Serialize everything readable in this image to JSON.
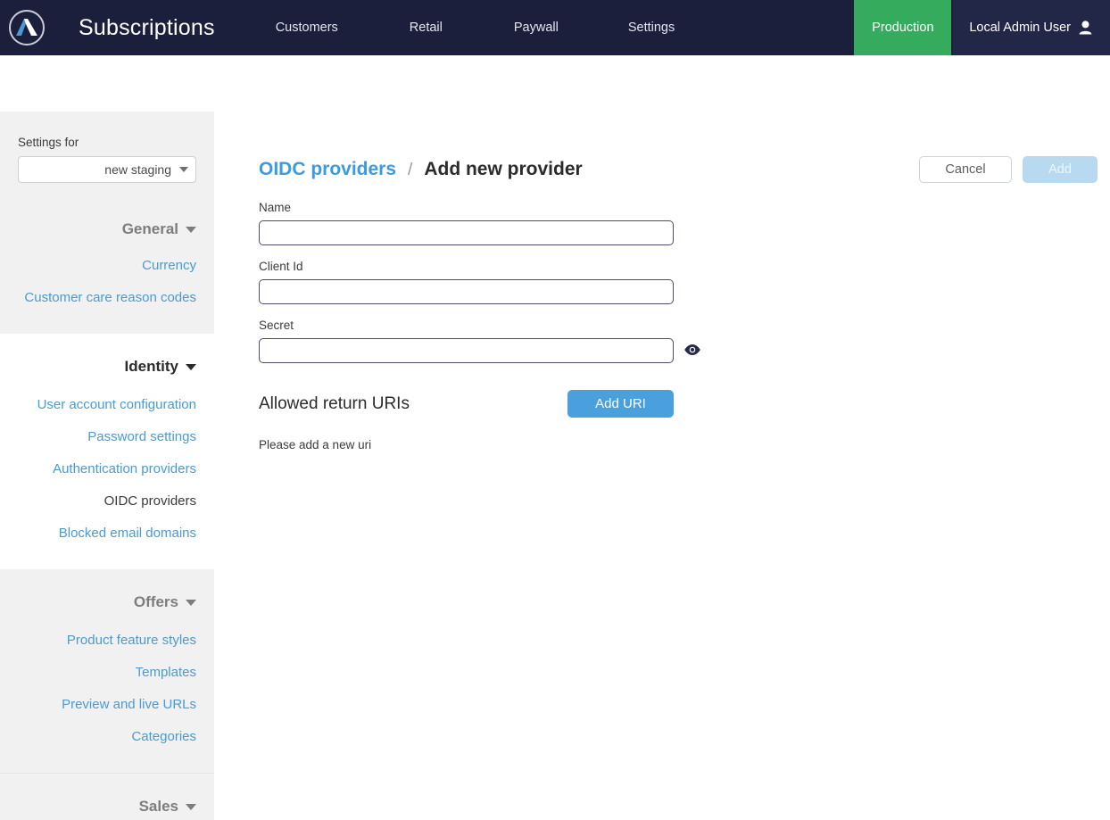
{
  "navbar": {
    "logo_name": "app-logo",
    "brand": "Subscriptions",
    "links": [
      {
        "label": "Customers",
        "name": "nav-link-customers"
      },
      {
        "label": "Retail",
        "name": "nav-link-retail"
      },
      {
        "label": "Paywall",
        "name": "nav-link-paywall"
      },
      {
        "label": "Settings",
        "name": "nav-link-settings"
      }
    ],
    "environment": "Production",
    "environment_color": "#35ab5e",
    "user": "Local Admin User",
    "background_color": "#1b1f3b"
  },
  "sidebar": {
    "settings_for_label": "Settings for",
    "environment_value": "new staging",
    "groups": [
      {
        "title": "General",
        "active": false,
        "links": [
          {
            "label": "Currency",
            "current": false
          },
          {
            "label": "Customer care reason codes",
            "current": false
          }
        ]
      },
      {
        "title": "Identity",
        "active": true,
        "links": [
          {
            "label": "User account configuration",
            "current": false
          },
          {
            "label": "Password settings",
            "current": false
          },
          {
            "label": "Authentication providers",
            "current": false
          },
          {
            "label": "OIDC providers",
            "current": true
          },
          {
            "label": "Blocked email domains",
            "current": false
          }
        ]
      },
      {
        "title": "Offers",
        "active": false,
        "links": [
          {
            "label": "Product feature styles",
            "current": false
          },
          {
            "label": "Templates",
            "current": false
          },
          {
            "label": "Preview and live URLs",
            "current": false
          },
          {
            "label": "Categories",
            "current": false
          }
        ]
      },
      {
        "title": "Sales",
        "active": false,
        "links": []
      }
    ]
  },
  "main": {
    "breadcrumb": {
      "parent": "OIDC providers",
      "separator": "/",
      "current": "Add new provider"
    },
    "actions": {
      "cancel_label": "Cancel",
      "add_label": "Add"
    },
    "form": {
      "name_label": "Name",
      "name_value": "",
      "name_placeholder": "",
      "client_id_label": "Client Id",
      "client_id_value": "",
      "client_id_placeholder": "",
      "secret_label": "Secret",
      "secret_value": "",
      "secret_placeholder": ""
    },
    "uris": {
      "title": "Allowed return URIs",
      "add_button_label": "Add URI",
      "empty_message": "Please add a new uri",
      "add_button_color": "#4aa0dd"
    }
  }
}
